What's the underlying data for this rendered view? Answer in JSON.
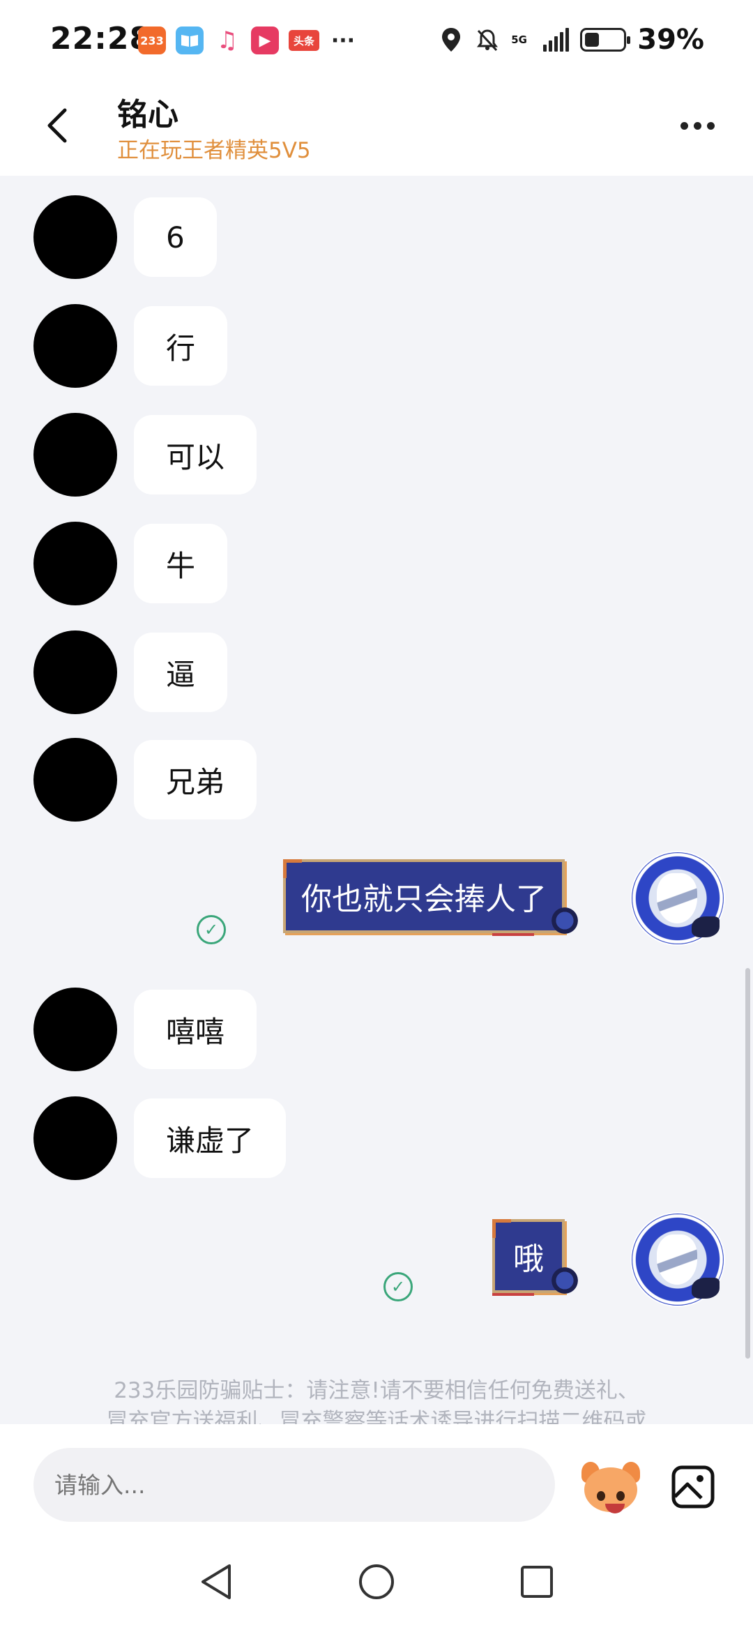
{
  "status_bar": {
    "time": "22:28",
    "apps": [
      {
        "icon": "app-233-icon",
        "label": "233"
      },
      {
        "icon": "reader-app-icon",
        "label": ""
      },
      {
        "icon": "music-app-icon",
        "label": "♫"
      },
      {
        "icon": "video-app-icon",
        "label": "▶"
      },
      {
        "icon": "toutiao-app-icon",
        "label": "头条"
      }
    ],
    "more": "···",
    "network": "5G",
    "battery": "39%",
    "battery_level": 0.39
  },
  "header": {
    "name": "铭心",
    "status": "正在玩王者精英5V5"
  },
  "messages": [
    {
      "from": "other",
      "text": "6"
    },
    {
      "from": "other",
      "text": "行"
    },
    {
      "from": "other",
      "text": "可以"
    },
    {
      "from": "other",
      "text": "牛"
    },
    {
      "from": "other",
      "text": "逼"
    },
    {
      "from": "other",
      "text": "兄弟"
    },
    {
      "from": "self",
      "text": "你也就只会捧人了",
      "status": "sent"
    },
    {
      "from": "other",
      "text": "嘻嘻"
    },
    {
      "from": "other",
      "text": "谦虚了"
    },
    {
      "from": "self",
      "text": "哦",
      "status": "sent"
    }
  ],
  "tip": {
    "line1": "233乐园防骗贴士：请注意!请不要相信任何免费送礼、",
    "line2": "冒充官方送福利、冒充警察等话术诱导进行扫描二维码或"
  },
  "input": {
    "placeholder": "请输入..."
  },
  "colors": {
    "status_orange": "#e08f3c",
    "self_bubble": "#2f3a8f",
    "check_green": "#3aa67a"
  }
}
